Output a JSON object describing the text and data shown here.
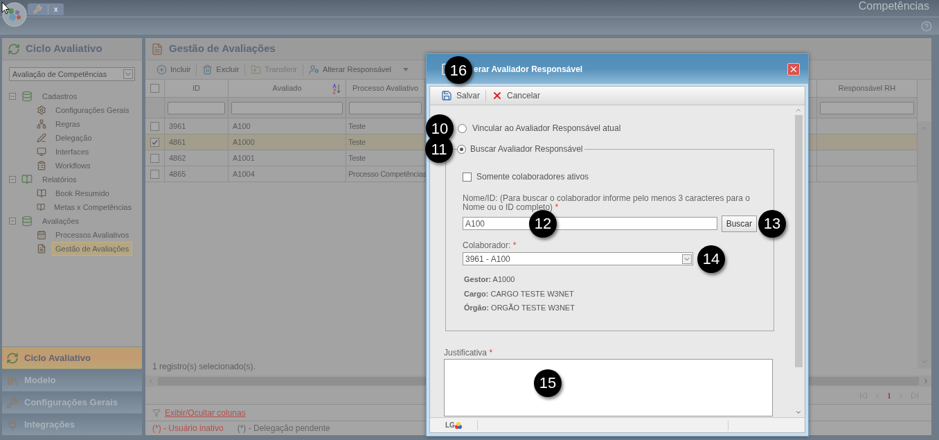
{
  "app": {
    "title": "Competências",
    "tab_close": "x"
  },
  "sidebar": {
    "title": "Ciclo Avaliativo",
    "select": {
      "value": "Avaliação de Competências"
    },
    "tree": [
      {
        "label": "Cadastros",
        "expanded": true,
        "children": [
          {
            "label": "Configurações Gerais",
            "selected": false
          },
          {
            "label": "Regras",
            "selected": false
          },
          {
            "label": "Delegação",
            "selected": false
          },
          {
            "label": "Interfaces",
            "selected": false
          },
          {
            "label": "Workflows",
            "selected": false
          }
        ]
      },
      {
        "label": "Relatórios",
        "expanded": true,
        "children": [
          {
            "label": "Book Resumido",
            "selected": false
          },
          {
            "label": "Metas x Competências",
            "selected": false
          }
        ]
      },
      {
        "label": "Avaliações",
        "expanded": true,
        "children": [
          {
            "label": "Processos Avaliativos",
            "selected": false
          },
          {
            "label": "Gestão de Avaliações",
            "selected": true
          }
        ]
      }
    ],
    "sections": [
      {
        "label": "Ciclo Avaliativo",
        "selected": true
      },
      {
        "label": "Modelo",
        "selected": false
      },
      {
        "label": "Configurações Gerais",
        "selected": false
      },
      {
        "label": "Integrações",
        "selected": false
      }
    ]
  },
  "main": {
    "title": "Gestão de Avaliações",
    "toolbar": [
      {
        "label": "Incluir",
        "disabled": false,
        "menu": false
      },
      {
        "label": "Excluir",
        "disabled": false,
        "menu": false
      },
      {
        "label": "Transferir",
        "disabled": true,
        "menu": false
      },
      {
        "label": "Alterar Responsável",
        "disabled": false,
        "menu": true
      }
    ],
    "table": {
      "header_checked": false,
      "columns": [
        {
          "label": "ID",
          "sorted": false
        },
        {
          "label": "Avaliado",
          "sorted": true
        },
        {
          "label": "Processo Avaliativo",
          "sorted": false
        },
        {
          "label": "Responsável RH",
          "sorted": false
        }
      ],
      "rows": [
        {
          "id": "3961",
          "avaliado": "A100",
          "processo": "Teste",
          "selected": false
        },
        {
          "id": "4861",
          "avaliado": "A1000",
          "processo": "Teste",
          "selected": true
        },
        {
          "id": "4862",
          "avaliado": "A1001",
          "processo": "Teste",
          "selected": false
        },
        {
          "id": "4865",
          "avaliado": "A1004",
          "processo": "Processo Competências",
          "selected": false
        }
      ]
    },
    "status": "1 registro(s) selecionado(s).",
    "page": "1",
    "columns_link": "Exibir/Ocultar colunas",
    "legend": [
      {
        "text": "(*) - Usuário inativo",
        "color": "#b3504c"
      },
      {
        "text": "(*) - Delegação pendente",
        "color": "#666666"
      }
    ]
  },
  "dialog": {
    "title": "erar Avaliador Responsável",
    "callout": "16",
    "toolbar": [
      {
        "label": "Salvar"
      },
      {
        "label": "Cancelar"
      }
    ],
    "options": [
      {
        "label": "Vincular ao Avaliador Responsável atual",
        "selected": false,
        "callout": "10"
      },
      {
        "label": "Buscar Avaliador Responsável",
        "selected": true,
        "callout": "11"
      }
    ],
    "only_active": {
      "label": "Somente colaboradores ativos",
      "checked": false
    },
    "name_field": {
      "label": "Nome/ID: (Para buscar o colaborador informe pelo menos 3 caracteres para o Nome ou o ID completo)",
      "required_mark": "*",
      "value": "A100",
      "callout": "12"
    },
    "search_button": {
      "label": "Buscar",
      "callout": "13"
    },
    "collaborator": {
      "label": "Colaborador:",
      "required_mark": "*",
      "value": "3961 - A100",
      "callout": "14"
    },
    "details": [
      "**Gestor:** A1000",
      "**Cargo:** CARGO TESTE W3NET",
      "**Órgão:** ORGÃO TESTE W3NET"
    ],
    "justification": {
      "label": "Justificativa",
      "required_mark": "*",
      "callout": "15"
    },
    "footer_logo": "LG"
  }
}
